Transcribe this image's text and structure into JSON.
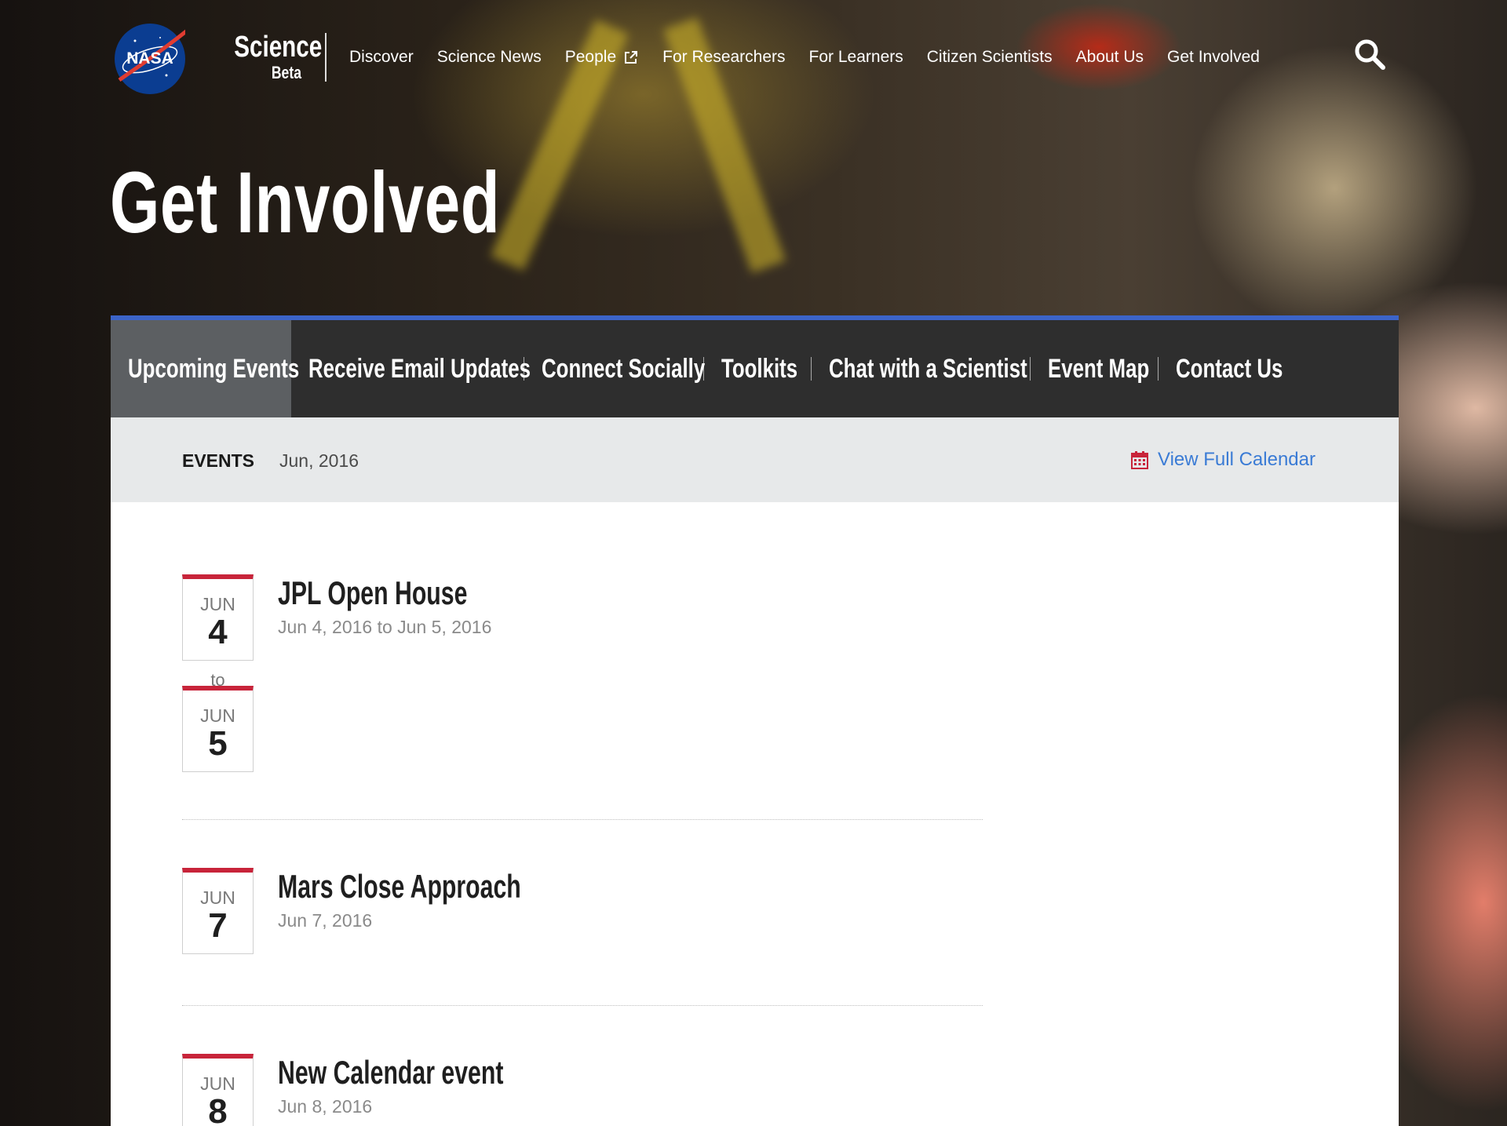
{
  "site": {
    "logo_text": "NASA",
    "name": "Science",
    "tagline": "Beta"
  },
  "main_menu": [
    {
      "label": "Discover"
    },
    {
      "label": "Science News"
    },
    {
      "label": "People",
      "external": true
    },
    {
      "label": "For Researchers"
    },
    {
      "label": "For Learners"
    },
    {
      "label": "Citizen Scientists"
    },
    {
      "label": "About Us"
    },
    {
      "label": "Get Involved"
    }
  ],
  "page_title": "Get Involved",
  "sub_nav": [
    {
      "label": "Upcoming Events",
      "active": true
    },
    {
      "label": "Receive Email Updates"
    },
    {
      "label": "Connect Socially"
    },
    {
      "label": "Toolkits"
    },
    {
      "label": "Chat with a Scientist"
    },
    {
      "label": "Event Map"
    },
    {
      "label": "Contact Us"
    }
  ],
  "events_bar": {
    "label": "EVENTS",
    "month": "Jun, 2016",
    "calendar_link": "View Full Calendar"
  },
  "events": [
    {
      "title": "JPL Open House",
      "dates": "Jun 4, 2016 to Jun 5, 2016",
      "start": {
        "mon": "JUN",
        "day": "4"
      },
      "to": "to",
      "end": {
        "mon": "JUN",
        "day": "5"
      }
    },
    {
      "title": "Mars Close Approach",
      "dates": "Jun 7, 2016",
      "start": {
        "mon": "JUN",
        "day": "7"
      }
    },
    {
      "title": "New Calendar event",
      "dates": "Jun 8, 2016",
      "start": {
        "mon": "JUN",
        "day": "8"
      }
    }
  ],
  "colors": {
    "accent_red": "#c8243a",
    "link_blue": "#3a7bd5",
    "subnav_bg": "#2e2e2e",
    "subnav_active": "#5c5f62",
    "subnav_top_border": "#3c64c8"
  }
}
